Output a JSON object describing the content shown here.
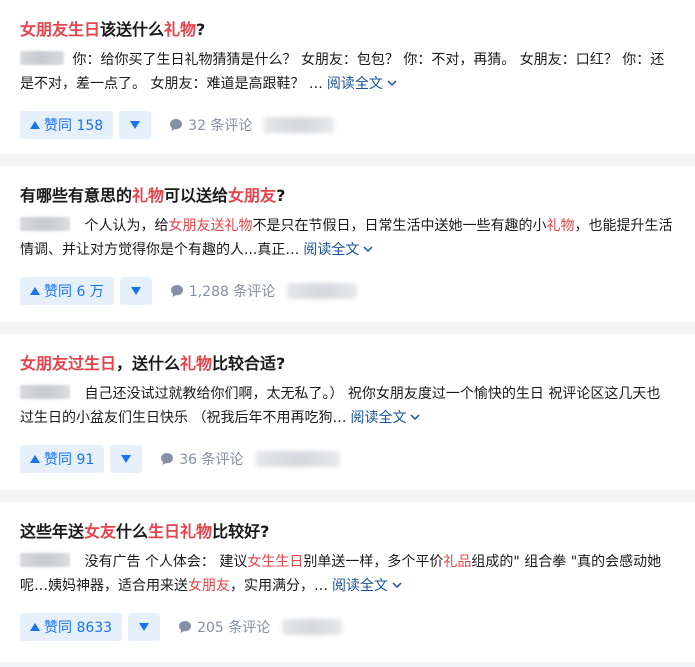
{
  "colors": {
    "highlight": "#e8424a",
    "link": "#175199",
    "vote_bg": "#e5f0fb",
    "vote_fg": "#1772f6",
    "meta": "#8590a6"
  },
  "cards": [
    {
      "title_parts": [
        {
          "text": "女朋友生日",
          "hl": true
        },
        {
          "text": "该送什么",
          "hl": false
        },
        {
          "text": "礼物",
          "hl": true
        },
        {
          "text": "?",
          "hl": false
        }
      ],
      "excerpt_parts": [
        {
          "text": "你：给你买了生日礼物猜猜是什么？ 女朋友：包包？ 你：不对，再猜。 女朋友：口红？ 你：还是不对，差一点了。 女朋友：难道是高跟鞋？ …",
          "hl": false
        }
      ],
      "read_more": "阅读全文",
      "vote_label": "赞同 158",
      "comment_label": "32 条评论"
    },
    {
      "title_parts": [
        {
          "text": "有哪些有意思的",
          "hl": false
        },
        {
          "text": "礼物",
          "hl": true
        },
        {
          "text": "可以送给",
          "hl": false
        },
        {
          "text": "女朋友",
          "hl": true
        },
        {
          "text": "?",
          "hl": false
        }
      ],
      "excerpt_parts": [
        {
          "text": "个人认为，给",
          "hl": false
        },
        {
          "text": "女朋友送礼物",
          "hl": true
        },
        {
          "text": "不是只在节假日，日常生活中送她一些有趣的小",
          "hl": false
        },
        {
          "text": "礼物",
          "hl": true
        },
        {
          "text": "，也能提升生活情调、并让对方觉得你是个有趣的人...真正…",
          "hl": false
        }
      ],
      "read_more": "阅读全文",
      "vote_label": "赞同 6 万",
      "comment_label": "1,288 条评论"
    },
    {
      "title_parts": [
        {
          "text": "女朋友过生日",
          "hl": true
        },
        {
          "text": "，送什么",
          "hl": false
        },
        {
          "text": "礼物",
          "hl": true
        },
        {
          "text": "比较合适?",
          "hl": false
        }
      ],
      "excerpt_parts": [
        {
          "text": "自己还没试过就教给你们啊，太无私了。） 祝你女朋友度过一个愉快的生日 祝评论区这几天也过生日的小盆友们生日快乐 （祝我后年不用再吃狗…",
          "hl": false
        }
      ],
      "read_more": "阅读全文",
      "vote_label": "赞同 91",
      "comment_label": "36 条评论"
    },
    {
      "title_parts": [
        {
          "text": "这些年送",
          "hl": false
        },
        {
          "text": "女友",
          "hl": true
        },
        {
          "text": "什么",
          "hl": false
        },
        {
          "text": "生日礼物",
          "hl": true
        },
        {
          "text": "比较好?",
          "hl": false
        }
      ],
      "excerpt_parts": [
        {
          "text": "没有广告 个人体会： 建议",
          "hl": false
        },
        {
          "text": "女生生日",
          "hl": true
        },
        {
          "text": "别单送一样，多个平价",
          "hl": false
        },
        {
          "text": "礼品",
          "hl": true
        },
        {
          "text": "组成的\" 组合拳 \"真的会感动她呢…姨妈神器，适合用来送",
          "hl": false
        },
        {
          "text": "女朋友",
          "hl": true
        },
        {
          "text": "，实用满分，…",
          "hl": false
        }
      ],
      "read_more": "阅读全文",
      "vote_label": "赞同 8633",
      "comment_label": "205 条评论"
    }
  ]
}
